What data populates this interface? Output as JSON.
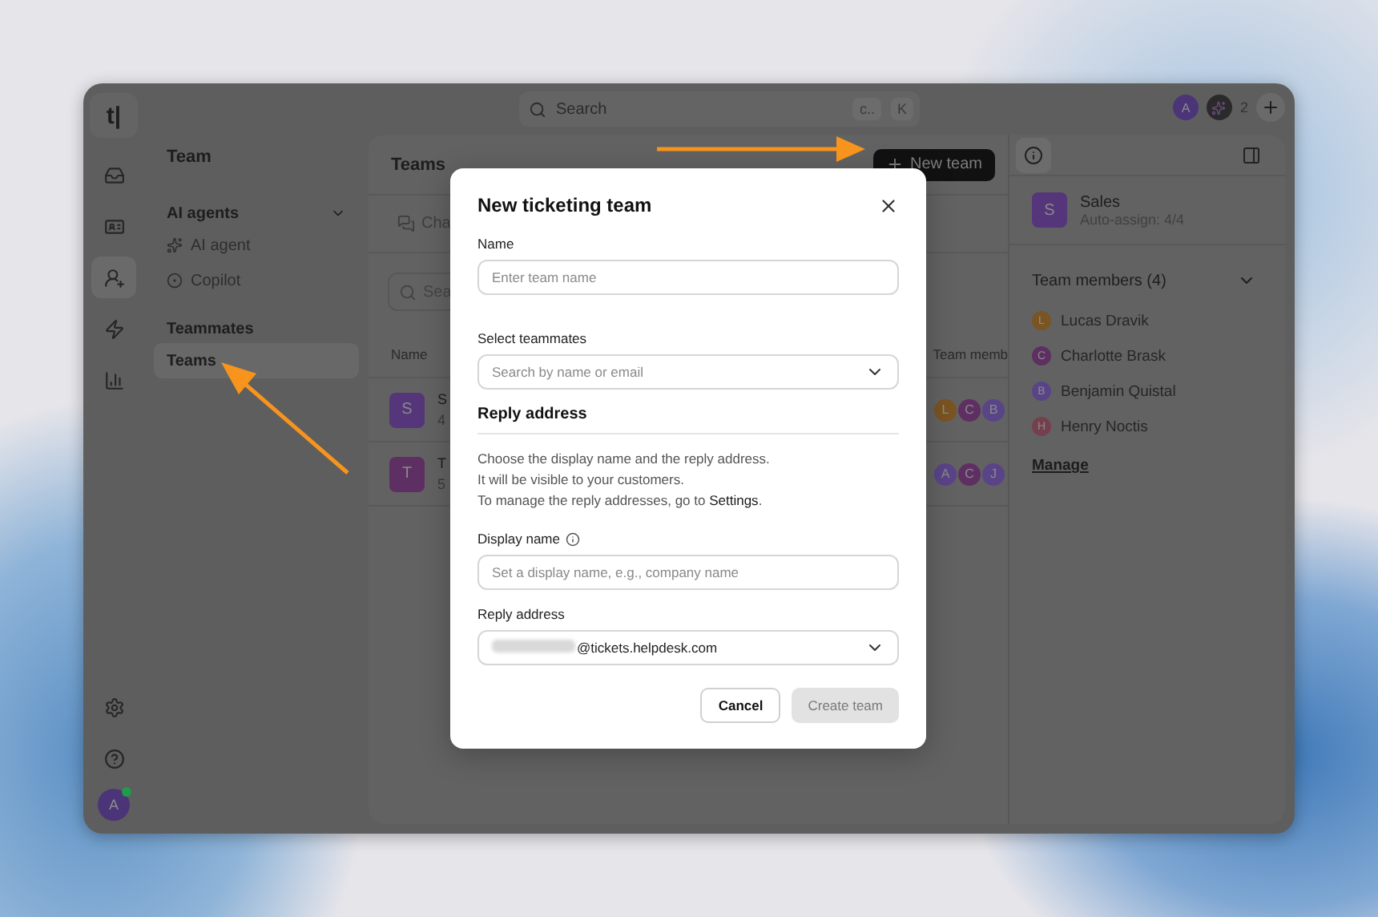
{
  "rail": {
    "logo": "t|",
    "items": [
      {
        "selected": false
      },
      {
        "selected": false
      },
      {
        "selected": true
      },
      {
        "selected": false
      },
      {
        "selected": false
      }
    ],
    "avatar": {
      "initial": "A",
      "online": true
    }
  },
  "topbar": {
    "search": {
      "placeholder": "Search",
      "keys": [
        "c..",
        "K"
      ]
    },
    "avatar": "A",
    "count": "2"
  },
  "sidebar": {
    "title": "Team",
    "groups": [
      {
        "label": "AI agents",
        "expanded": true,
        "items": [
          {
            "label": "AI agent",
            "selected": false
          },
          {
            "label": "Copilot",
            "selected": false
          }
        ]
      },
      {
        "label": "Teammates",
        "items": [
          {
            "label": "Teams",
            "selected": true
          }
        ]
      }
    ]
  },
  "main": {
    "title": "Teams",
    "new_button": "New team",
    "tab": "Cha",
    "search_placeholder": "Sea",
    "columns": [
      "Name",
      "Team memb"
    ],
    "rows": [
      {
        "initial": "S",
        "name": "S",
        "sub": "4",
        "color": "#55367a",
        "members": [
          {
            "initial": "L",
            "color": "#7a5422"
          },
          {
            "initial": "C",
            "color": "#5e2f62"
          },
          {
            "initial": "B",
            "color": "#5a4488"
          }
        ]
      },
      {
        "initial": "T",
        "name": "T",
        "sub": "5",
        "color": "#5e2f62",
        "members": [
          {
            "initial": "A",
            "color": "#5a4488"
          },
          {
            "initial": "C",
            "color": "#5e2f62"
          },
          {
            "initial": "J",
            "color": "#5a4488"
          }
        ]
      }
    ]
  },
  "details": {
    "team": {
      "initial": "S",
      "name": "Sales",
      "sub": "Auto-assign: 4/4"
    },
    "members_title": "Team members (4)",
    "members_expanded": true,
    "members": [
      {
        "initial": "L",
        "name": "Lucas Dravik",
        "color": "#7a5422"
      },
      {
        "initial": "C",
        "name": "Charlotte Brask",
        "color": "#5e2f62"
      },
      {
        "initial": "B",
        "name": "Benjamin Quistal",
        "color": "#5a4488"
      },
      {
        "initial": "H",
        "name": "Henry Noctis",
        "color": "#74404e"
      }
    ],
    "manage": "Manage"
  },
  "modal": {
    "title": "New ticketing team",
    "name_label": "Name",
    "name_placeholder": "Enter team name",
    "teammates_label": "Select teammates",
    "teammates_placeholder": "Search by name or email",
    "section": "Reply address",
    "description": [
      "Choose the display name and the reply address.",
      "It will be visible to your customers.",
      "To manage the reply addresses, go to **Settings**."
    ],
    "display_label": "Display name",
    "display_placeholder": "Set a display name, e.g., company name",
    "reply_label": "Reply address",
    "reply_value": "@tickets.helpdesk.com",
    "buttons": [
      {
        "label": "Cancel",
        "kind": "secondary",
        "disabled": false
      },
      {
        "label": "Create team",
        "kind": "primary",
        "disabled": true
      }
    ]
  }
}
